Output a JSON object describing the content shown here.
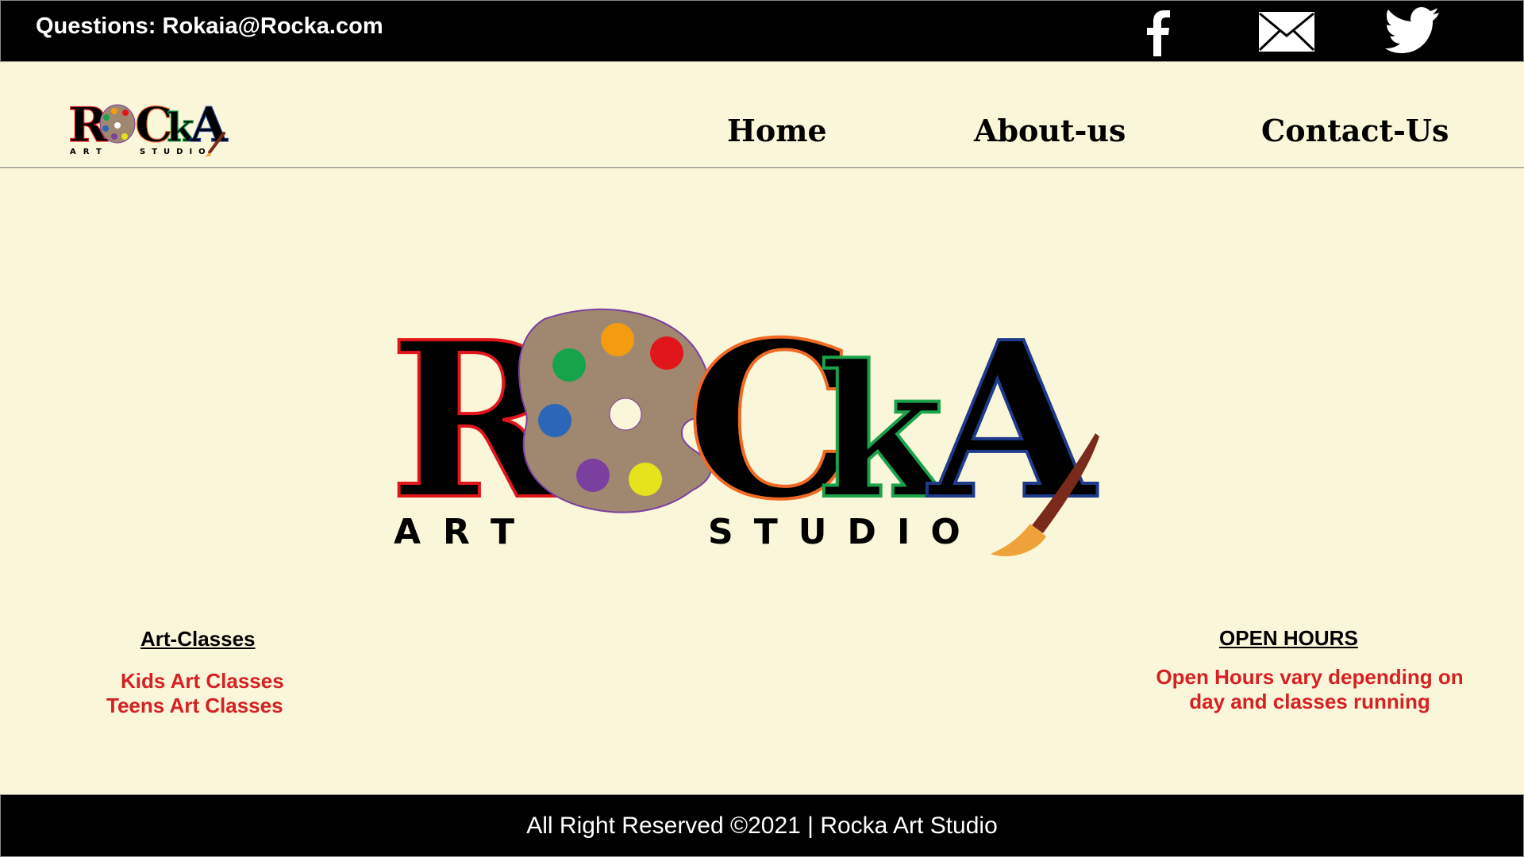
{
  "topbar": {
    "contact_text": "Questions: Rokaia@Rocka.com",
    "social_icons": [
      "facebook-icon",
      "mail-icon",
      "twitter-icon"
    ]
  },
  "logo": {
    "letters": [
      "R",
      "C",
      "k",
      "A"
    ],
    "subtitle_left": "ART",
    "subtitle_right": "STUDIO",
    "palette_colors": [
      "#f39c12",
      "#e0161b",
      "#16a34a",
      "#2c66b8",
      "#7b3fa0",
      "#e6e21b"
    ],
    "outline_colors": [
      "#e0161b",
      "#f06a23",
      "#1aa34a",
      "#1e3a8a"
    ]
  },
  "nav": {
    "home": "Home",
    "about": "About-us",
    "contact": "Contact-Us"
  },
  "classes": {
    "title": "Art-Classes",
    "items": [
      "Kids Art Classes",
      "Teens Art Classes"
    ]
  },
  "hours": {
    "title": "OPEN HOURS",
    "line1": "Open Hours vary depending on",
    "line2": "day and classes running"
  },
  "footer": {
    "text": "All Right Reserved ©2021 | Rocka Art Studio"
  },
  "colors": {
    "background": "#faf6da",
    "bar": "#000000",
    "accent_red": "#d52121"
  }
}
